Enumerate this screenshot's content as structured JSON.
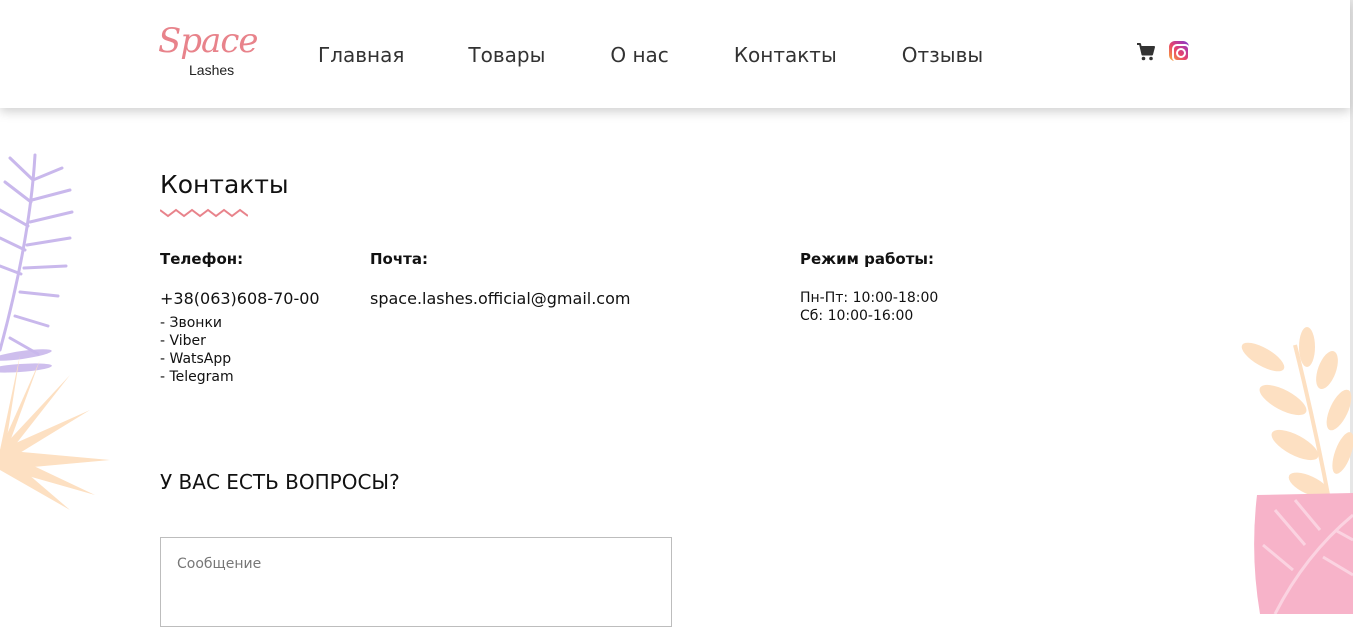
{
  "header": {
    "logo": {
      "script": "Space",
      "sub": "Lashes"
    },
    "nav": [
      "Главная",
      "Товары",
      "О нас",
      "Контакты",
      "Отзывы"
    ],
    "icons": {
      "cart": "cart-icon",
      "instagram": "instagram-icon"
    }
  },
  "contacts": {
    "title": "Контакты",
    "phone": {
      "label": "Телефон:",
      "number": "+38(063)608-70-00",
      "methods": [
        "- Звонки",
        "- Viber",
        "- WatsApp",
        "- Telegram"
      ]
    },
    "mail": {
      "label": "Почта:",
      "value": "space.lashes.official@gmail.com"
    },
    "hours": {
      "label": "Режим работы:",
      "lines": [
        "Пн-Пт: 10:00-18:00",
        "Сб: 10:00-16:00"
      ]
    }
  },
  "questions": {
    "title": "У ВАС ЕСТЬ ВОПРОСЫ?",
    "message_placeholder": "Сообщение"
  },
  "colors": {
    "accent": "#e8838b",
    "leaf_lavender": "#c9b8ec",
    "leaf_peach": "#fde0c2",
    "leaf_pink": "#f7b3c9"
  }
}
